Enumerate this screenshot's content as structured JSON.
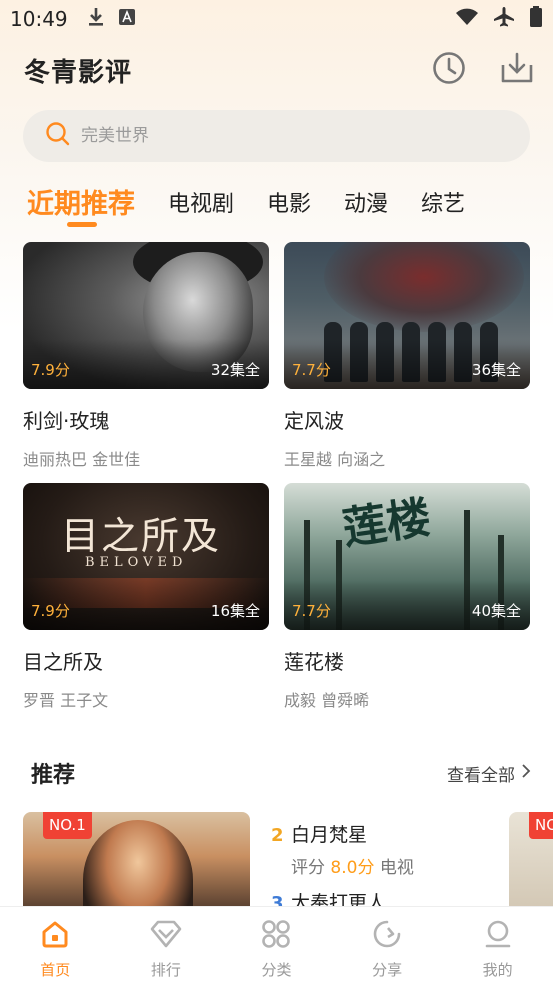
{
  "status_bar": {
    "time": "10:49"
  },
  "header": {
    "title": "冬青影评"
  },
  "search": {
    "placeholder": "完美世界"
  },
  "tabs": [
    {
      "label": "近期推荐",
      "active": true
    },
    {
      "label": "电视剧",
      "active": false
    },
    {
      "label": "电影",
      "active": false
    },
    {
      "label": "动漫",
      "active": false
    },
    {
      "label": "综艺",
      "active": false
    }
  ],
  "cards": [
    {
      "title": "利剑·玫瑰",
      "cast": "迪丽热巴 金世佳",
      "score": "7.9分",
      "episodes": "32集全"
    },
    {
      "title": "定风波",
      "cast": "王星越 向涵之",
      "score": "7.7分",
      "episodes": "36集全"
    },
    {
      "title": "目之所及",
      "cast": "罗晋 王子文",
      "score": "7.9分",
      "episodes": "16集全"
    },
    {
      "title": "莲花楼",
      "cast": "成毅 曾舜晞",
      "score": "7.7分",
      "episodes": "40集全"
    }
  ],
  "poster_text": {
    "p3_logo": "目之所及",
    "p3_sub": "BELOVED",
    "p4_logo": "莲楼"
  },
  "recommend": {
    "title": "推荐",
    "see_all": "查看全部",
    "badge": "NO.1",
    "badge2": "NO",
    "ranks": [
      {
        "num": "2",
        "title": "白月梵星",
        "score_label": "评分",
        "score": "8.0分",
        "type": "电视",
        "color": "#f2a623"
      },
      {
        "num": "3",
        "title": "大奉打更人",
        "color": "#3e7bd6"
      }
    ]
  },
  "bottom_nav": [
    {
      "label": "首页",
      "icon": "home-icon",
      "active": true
    },
    {
      "label": "排行",
      "icon": "diamond-icon",
      "active": false
    },
    {
      "label": "分类",
      "icon": "grid-icon",
      "active": false
    },
    {
      "label": "分享",
      "icon": "share-icon",
      "active": false
    },
    {
      "label": "我的",
      "icon": "profile-icon",
      "active": false
    }
  ],
  "colors": {
    "accent": "#ff8a1f",
    "score": "#ffb13b",
    "badge": "#f04234"
  }
}
